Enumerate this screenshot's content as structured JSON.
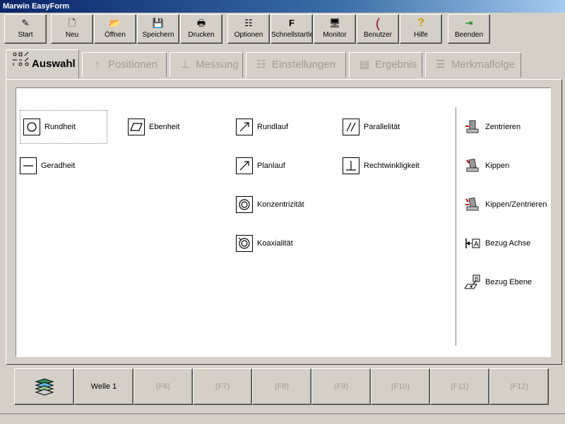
{
  "window": {
    "title": "Marwin EasyForm"
  },
  "toolbar": [
    {
      "name": "start-button",
      "label": "Start",
      "icon": "✎"
    },
    {
      "name": "neu-button",
      "label": "Neu",
      "icon": "🗋"
    },
    {
      "name": "oeffnen-button",
      "label": "Öffnen",
      "icon": "📂"
    },
    {
      "name": "speichern-button",
      "label": "Speichern",
      "icon": "💾"
    },
    {
      "name": "drucken-button",
      "label": "Drucken",
      "icon": "🖶"
    },
    {
      "name": "optionen-button",
      "label": "Optionen",
      "icon": "☷"
    },
    {
      "name": "schnellstart-button",
      "label": "Schnellstartle...",
      "icon": "F"
    },
    {
      "name": "monitor-button",
      "label": "Monitor",
      "icon": "🖥"
    },
    {
      "name": "benutzer-button",
      "label": "Benutzer",
      "icon": "("
    },
    {
      "name": "hilfe-button",
      "label": "Hilfe",
      "icon": "?"
    },
    {
      "name": "beenden-button",
      "label": "Beenden",
      "icon": "⇥"
    }
  ],
  "tabs": [
    {
      "label": "Auswahl",
      "active": true
    },
    {
      "label": "Positionen",
      "active": false
    },
    {
      "label": "Messung",
      "active": false
    },
    {
      "label": "Einstellungen",
      "active": false
    },
    {
      "label": "Ergebnis",
      "active": false
    },
    {
      "label": "Merkmalfolge",
      "active": false
    }
  ],
  "features": {
    "rundheit": "Rundheit",
    "geradheit": "Geradheit",
    "ebenheit": "Ebenheit",
    "rundlauf": "Rundlauf",
    "planlauf": "Planlauf",
    "konzentrizitaet": "Konzentrizität",
    "koaxialitaet": "Koaxialität",
    "parallelitaet": "Parallelität",
    "rechtwinkligkeit": "Rechtwinkligkeit"
  },
  "actions": {
    "zentrieren": "Zentrieren",
    "kippen": "Kippen",
    "kippen_zentrieren": "Kippen/Zentrieren",
    "bezug_achse": "Bezug Achse",
    "bezug_ebene": "Bezug Ebene"
  },
  "fbar": [
    {
      "label": "",
      "icon": "layers-icon",
      "disabled": false
    },
    {
      "label": "Welle 1",
      "disabled": false
    },
    {
      "label": "(F6)",
      "disabled": true
    },
    {
      "label": "(F7)",
      "disabled": true
    },
    {
      "label": "(F8)",
      "disabled": true
    },
    {
      "label": "(F9)",
      "disabled": true
    },
    {
      "label": "(F10)",
      "disabled": true
    },
    {
      "label": "(F11)",
      "disabled": true
    },
    {
      "label": "(F12)",
      "disabled": true
    }
  ],
  "colors": {
    "title_start": "#0a246a",
    "face": "#d4d0c8",
    "disabled_text": "#a09c94"
  }
}
